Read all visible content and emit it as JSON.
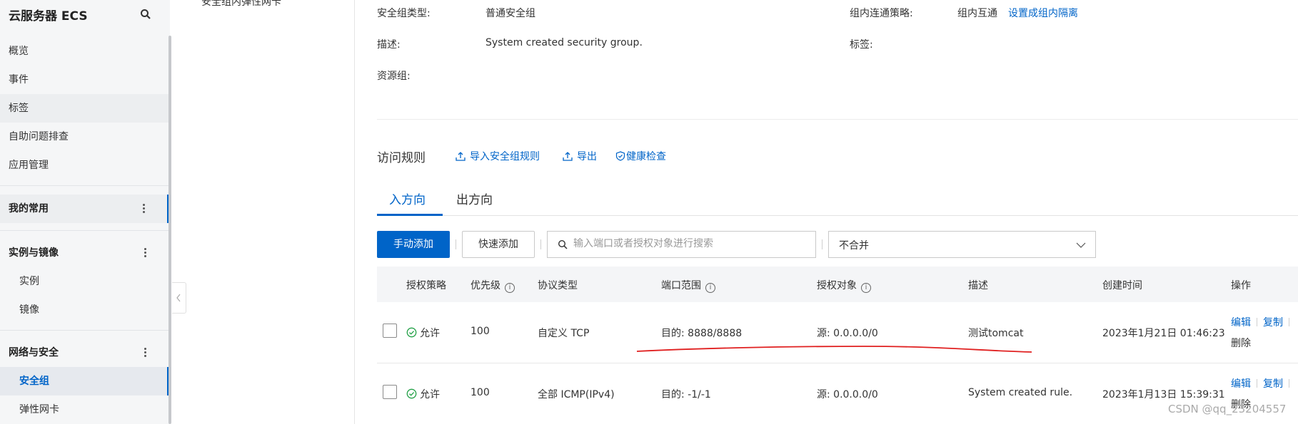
{
  "sidebar": {
    "title": "云服务器 ECS",
    "items": [
      {
        "label": "概览"
      },
      {
        "label": "事件"
      },
      {
        "label": "标签"
      },
      {
        "label": "自助问题排查"
      },
      {
        "label": "应用管理"
      }
    ],
    "groups": [
      {
        "label": "我的常用"
      },
      {
        "label": "实例与镜像",
        "children": [
          {
            "label": "实例"
          },
          {
            "label": "镜像"
          }
        ]
      },
      {
        "label": "网络与安全",
        "children": [
          {
            "label": "安全组"
          },
          {
            "label": "弹性网卡"
          }
        ]
      }
    ]
  },
  "subnav": {
    "item": "安全组内弹性网卡"
  },
  "info": {
    "sg_type_label": "安全组类型:",
    "sg_type_value": "普通安全组",
    "policy_label": "组内连通策略:",
    "policy_value": "组内互通",
    "policy_link": "设置成组内隔离",
    "desc_label": "描述:",
    "desc_value": "System created security group.",
    "tag_label": "标签:",
    "rg_label": "资源组:"
  },
  "rules": {
    "title": "访问规则",
    "import_label": "导入安全组规则",
    "export_label": "导出",
    "health_label": "健康检查"
  },
  "tabs": [
    {
      "label": "入方向"
    },
    {
      "label": "出方向"
    }
  ],
  "toolbar": {
    "manual_add": "手动添加",
    "quick_add": "快速添加",
    "search_placeholder": "输入端口或者授权对象进行搜索",
    "merge_value": "不合并"
  },
  "table": {
    "columns": [
      "授权策略",
      "优先级",
      "协议类型",
      "端口范围",
      "授权对象",
      "描述",
      "创建时间",
      "操作"
    ],
    "rows": [
      {
        "policy": "允许",
        "priority": "100",
        "protocol": "自定义 TCP",
        "port": "目的: 8888/8888",
        "object": "源: 0.0.0.0/0",
        "desc": "测试tomcat",
        "created": "2023年1月21日 01:46:23",
        "actions": {
          "edit": "编辑",
          "copy": "复制",
          "delete": "删除"
        }
      },
      {
        "policy": "允许",
        "priority": "100",
        "protocol": "全部 ICMP(IPv4)",
        "port": "目的: -1/-1",
        "object": "源: 0.0.0.0/0",
        "desc": "System created rule.",
        "created": "2023年1月13日 15:39:31",
        "actions": {
          "edit": "编辑",
          "copy": "复制",
          "delete": "删除"
        }
      }
    ]
  },
  "watermark": "CSDN @qq_23204557",
  "colors": {
    "accent": "#0064c8",
    "annotation": "#e02020",
    "success": "#24a148"
  }
}
